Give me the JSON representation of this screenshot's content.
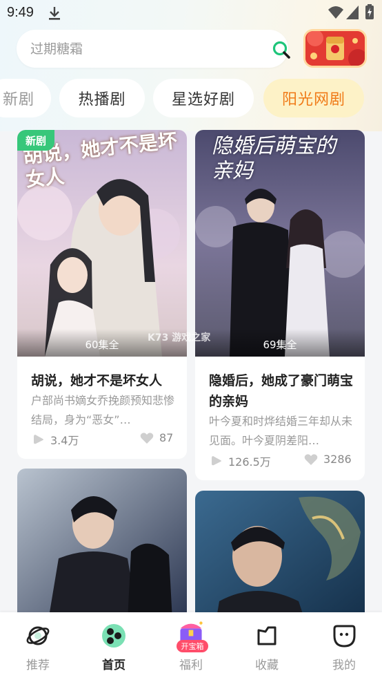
{
  "status_bar": {
    "time": "9:49"
  },
  "search": {
    "placeholder": "过期糖霜"
  },
  "tabs": [
    {
      "label": "新剧"
    },
    {
      "label": "热播剧"
    },
    {
      "label": "星选好剧"
    },
    {
      "label": "阳光网剧",
      "active": true
    }
  ],
  "cards": [
    {
      "badge": "新剧",
      "cover_text": "胡说，她才不是坏女人",
      "episodes": "60集全",
      "title": "胡说，她才不是坏女人",
      "description": "户部尚书嫡女乔挽颜预知悲惨结局，身为“恶女”…",
      "plays": "3.4万",
      "likes": "87"
    },
    {
      "cover_text": "隐婚后萌宝的亲妈",
      "episodes": "69集全",
      "title": "隐婚后，她成了豪门萌宝的亲妈",
      "description": "叶今夏和时烨结婚三年却从未见面。叶今夏阴差阳…",
      "plays": "126.5万",
      "likes": "3286"
    },
    {
      "cover_text": ""
    },
    {
      "cover_text": ""
    }
  ],
  "watermark": "K73 游戏之家",
  "bottom_nav": [
    {
      "label": "推荐",
      "icon": "planet-icon"
    },
    {
      "label": "首页",
      "icon": "home-dots-icon",
      "active": true
    },
    {
      "label": "福利",
      "icon": "treasure-box-icon",
      "badge": "开宝箱"
    },
    {
      "label": "收藏",
      "icon": "bookmark-folder-icon"
    },
    {
      "label": "我的",
      "icon": "profile-icon"
    }
  ],
  "colors": {
    "accent": "#f07a17",
    "active_tab_bg": "#fdf2c7",
    "badge_green": "#37c77a",
    "search_icon": "#1ec57a"
  }
}
